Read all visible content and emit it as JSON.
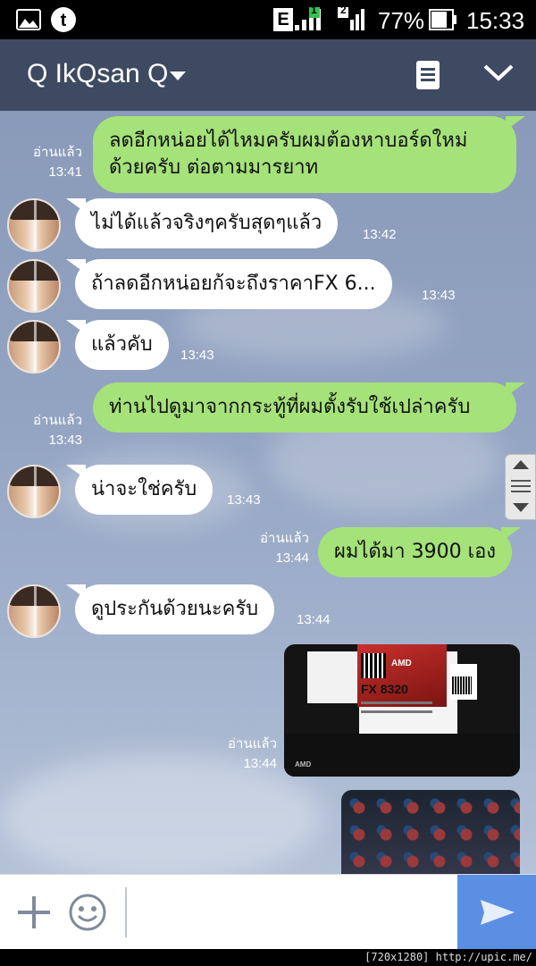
{
  "status_bar": {
    "network_label": "E",
    "sim1_label": "1",
    "sim2_label": "2",
    "battery": "77%",
    "time": "15:33",
    "icons": [
      "gallery-icon",
      "tumblr-icon",
      "signal-sim1-icon",
      "signal-sim2-icon",
      "battery-icon"
    ]
  },
  "header": {
    "title": "Q IkQsan Q",
    "icons": [
      "chevron-down-icon",
      "memo-icon",
      "collapse-chevron-icon"
    ]
  },
  "messages": [
    {
      "side": "out",
      "text": "ลดอีกหน่อยได้ไหมครับผมต้องหาบอร์ดใหม่ด้วยครับ ต่อตามมารยาท",
      "read": "อ่านแล้ว",
      "time": "13:41"
    },
    {
      "side": "in",
      "text": "ไม่ได้แล้วจริงๆครับสุดๆแล้ว",
      "time": "13:42"
    },
    {
      "side": "in",
      "text": "ถ้าลดอีกหน่อยก้จะถึงราคาFX 6...",
      "time": "13:43"
    },
    {
      "side": "in",
      "text": "แล้วคับ",
      "time": "13:43"
    },
    {
      "side": "out",
      "text": "ท่านไปดูมาจากกระทู้ที่ผมตั้งรับใช้เปล่าครับ",
      "read": "อ่านแล้ว",
      "time": "13:43"
    },
    {
      "side": "in",
      "text": "น่าจะใช่ครับ",
      "time": "13:43"
    },
    {
      "side": "out",
      "text": "ผมได้มา 3900 เอง",
      "read": "อ่านแล้ว",
      "time": "13:44"
    },
    {
      "side": "in",
      "text": "ดูประกันด้วยนะครับ",
      "time": "13:44"
    },
    {
      "side": "out",
      "type": "photo",
      "photo_text": {
        "brand": "AMD",
        "model": "FX 8320",
        "box_logo": "AMD"
      },
      "read": "อ่านแล้ว",
      "time": "13:44"
    },
    {
      "side": "out",
      "type": "photo"
    }
  ],
  "input": {
    "placeholder": ""
  },
  "colors": {
    "header": "#3e4a61",
    "outgoing_bubble": "#a5e27a",
    "incoming_bubble": "#ffffff",
    "send": "#5b8fe3"
  },
  "watermark": "[720x1280] http://upic.me/"
}
